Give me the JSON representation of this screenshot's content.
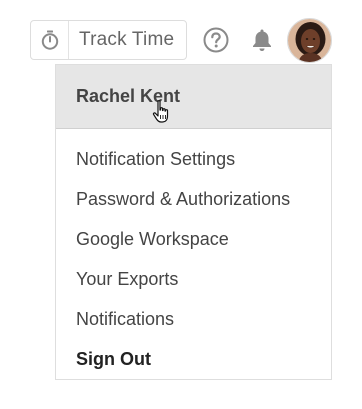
{
  "topbar": {
    "track_time_label": "Track Time",
    "icons": {
      "timer": "stopwatch-icon",
      "help": "question-circle-icon",
      "notifications": "bell-icon",
      "avatar": "user-avatar"
    }
  },
  "menu": {
    "user_name": "Rachel Kent",
    "items": [
      {
        "label": "Notification Settings"
      },
      {
        "label": "Password & Authorizations"
      },
      {
        "label": "Google Workspace"
      },
      {
        "label": "Your Exports"
      },
      {
        "label": "Notifications"
      },
      {
        "label": "Sign Out"
      }
    ]
  },
  "colors": {
    "header_bg": "#e6e6e6",
    "text": "#444444",
    "icon_gray": "#8a8a8a"
  }
}
